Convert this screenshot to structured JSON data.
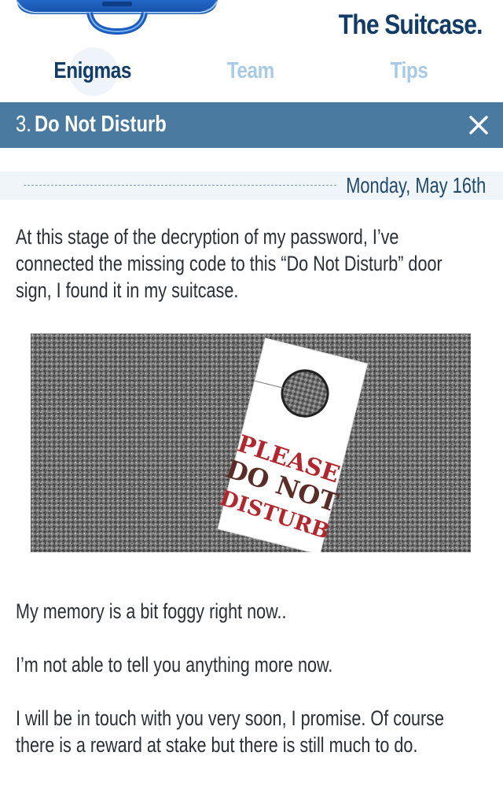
{
  "header": {
    "app_title": "The Suitcase.",
    "logo_icon": "suitcase-logo-icon"
  },
  "tabs": [
    {
      "label": "Enigmas",
      "active": true
    },
    {
      "label": "Team",
      "active": false
    },
    {
      "label": "Tips",
      "active": false
    }
  ],
  "enigma": {
    "number": "3.",
    "title": "Do Not Disturb",
    "close_icon": "close-icon",
    "date": "Monday, May 16th"
  },
  "content": {
    "paragraph_1": "At this stage of the decryption of my password, I’ve connected the missing code to  this “Do Not Disturb” door sign, I found it in my suitcase.",
    "sign_lines": [
      "PLEASE",
      "DO NOT",
      "DISTURB"
    ],
    "paragraph_2": "My memory is a bit foggy right now..",
    "paragraph_3": "I’m not able to tell you anything more now.",
    "paragraph_4": "I will be in touch with you very soon, I promise. Of course there is a reward at stake but there is still much to do."
  },
  "colors": {
    "brand_dark": "#123b67",
    "title_bar": "#4b7aa0",
    "tab_inactive": "#a7cbe6",
    "sign_red": "#b3262b"
  }
}
